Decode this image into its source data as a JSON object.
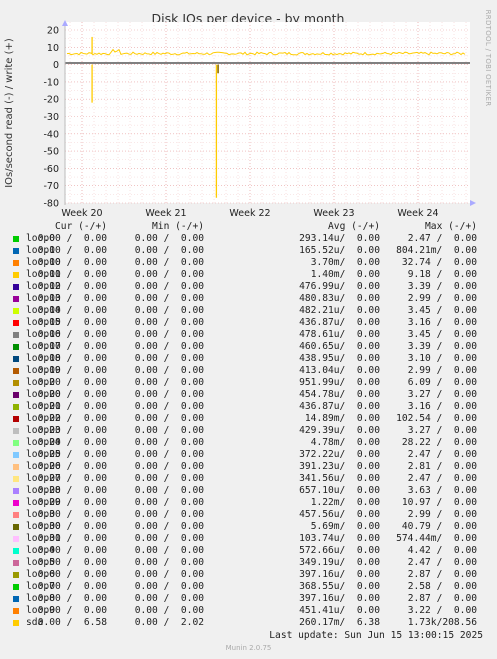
{
  "chart_data": {
    "type": "line",
    "title": "Disk IOs per device - by month",
    "ylabel": "IOs/second read (-) / write (+)",
    "ylim": [
      -80,
      20
    ],
    "yticks": [
      20,
      10,
      0,
      -10,
      -20,
      -30,
      -40,
      -50,
      -60,
      -70,
      -80
    ],
    "xticks": [
      "Week 20",
      "Week 21",
      "Week 22",
      "Week 23",
      "Week 24"
    ],
    "grid": true,
    "side_label": "RRDTOOL / TOBI OETIKER",
    "series": [
      {
        "name": "sda",
        "color": "#ffcc00",
        "write_baseline": 6.4,
        "spikes": [
          {
            "week": 0.12,
            "value": 16,
            "dir": "write"
          },
          {
            "week": 0.12,
            "value": -22,
            "dir": "read"
          },
          {
            "week": 1.6,
            "value": -77,
            "dir": "read"
          }
        ]
      }
    ],
    "dark_read_spike": {
      "week": 1.62,
      "value": -5
    }
  },
  "legend": {
    "headers": {
      "cur": "Cur (-/+)",
      "min": "Min (-/+)",
      "avg": "Avg (-/+)",
      "max": "Max (-/+)"
    },
    "rows": [
      {
        "name": "loop0",
        "color": "#00cc00",
        "cur": "0.00 /  0.00",
        "min": "0.00 /  0.00",
        "avg": "293.14u/  0.00",
        "max": "2.47 /  0.00"
      },
      {
        "name": "loop1",
        "color": "#0066b3",
        "cur": "0.00 /  0.00",
        "min": "0.00 /  0.00",
        "avg": "165.52u/  0.00",
        "max": "804.21m/  0.00"
      },
      {
        "name": "loop10",
        "color": "#ff8000",
        "cur": "0.00 /  0.00",
        "min": "0.00 /  0.00",
        "avg": "3.70m/  0.00",
        "max": "32.74 /  0.00"
      },
      {
        "name": "loop11",
        "color": "#ffcc00",
        "cur": "0.00 /  0.00",
        "min": "0.00 /  0.00",
        "avg": "1.40m/  0.00",
        "max": "9.18 /  0.00"
      },
      {
        "name": "loop12",
        "color": "#330099",
        "cur": "0.00 /  0.00",
        "min": "0.00 /  0.00",
        "avg": "476.99u/  0.00",
        "max": "3.39 /  0.00"
      },
      {
        "name": "loop13",
        "color": "#990099",
        "cur": "0.00 /  0.00",
        "min": "0.00 /  0.00",
        "avg": "480.83u/  0.00",
        "max": "2.99 /  0.00"
      },
      {
        "name": "loop14",
        "color": "#ccff00",
        "cur": "0.00 /  0.00",
        "min": "0.00 /  0.00",
        "avg": "482.21u/  0.00",
        "max": "3.45 /  0.00"
      },
      {
        "name": "loop15",
        "color": "#ff0000",
        "cur": "0.00 /  0.00",
        "min": "0.00 /  0.00",
        "avg": "436.87u/  0.00",
        "max": "3.16 /  0.00"
      },
      {
        "name": "loop16",
        "color": "#808080",
        "cur": "0.00 /  0.00",
        "min": "0.00 /  0.00",
        "avg": "478.61u/  0.00",
        "max": "3.45 /  0.00"
      },
      {
        "name": "loop17",
        "color": "#008f00",
        "cur": "0.00 /  0.00",
        "min": "0.00 /  0.00",
        "avg": "460.65u/  0.00",
        "max": "3.39 /  0.00"
      },
      {
        "name": "loop18",
        "color": "#00487d",
        "cur": "0.00 /  0.00",
        "min": "0.00 /  0.00",
        "avg": "438.95u/  0.00",
        "max": "3.10 /  0.00"
      },
      {
        "name": "loop19",
        "color": "#b35a00",
        "cur": "0.00 /  0.00",
        "min": "0.00 /  0.00",
        "avg": "413.04u/  0.00",
        "max": "2.99 /  0.00"
      },
      {
        "name": "loop2",
        "color": "#b38f00",
        "cur": "0.00 /  0.00",
        "min": "0.00 /  0.00",
        "avg": "951.99u/  0.00",
        "max": "6.09 /  0.00"
      },
      {
        "name": "loop20",
        "color": "#6b006b",
        "cur": "0.00 /  0.00",
        "min": "0.00 /  0.00",
        "avg": "454.78u/  0.00",
        "max": "3.27 /  0.00"
      },
      {
        "name": "loop21",
        "color": "#8fb300",
        "cur": "0.00 /  0.00",
        "min": "0.00 /  0.00",
        "avg": "436.87u/  0.00",
        "max": "3.16 /  0.00"
      },
      {
        "name": "loop22",
        "color": "#b30000",
        "cur": "0.00 /  0.00",
        "min": "0.00 /  0.00",
        "avg": "14.89m/  0.00",
        "max": "102.54 /  0.00"
      },
      {
        "name": "loop23",
        "color": "#bebebe",
        "cur": "0.00 /  0.00",
        "min": "0.00 /  0.00",
        "avg": "429.39u/  0.00",
        "max": "3.27 /  0.00"
      },
      {
        "name": "loop24",
        "color": "#80ff80",
        "cur": "0.00 /  0.00",
        "min": "0.00 /  0.00",
        "avg": "4.78m/  0.00",
        "max": "28.22 /  0.00"
      },
      {
        "name": "loop25",
        "color": "#80c9ff",
        "cur": "0.00 /  0.00",
        "min": "0.00 /  0.00",
        "avg": "372.22u/  0.00",
        "max": "2.47 /  0.00"
      },
      {
        "name": "loop26",
        "color": "#ffc080",
        "cur": "0.00 /  0.00",
        "min": "0.00 /  0.00",
        "avg": "391.23u/  0.00",
        "max": "2.81 /  0.00"
      },
      {
        "name": "loop27",
        "color": "#ffe680",
        "cur": "0.00 /  0.00",
        "min": "0.00 /  0.00",
        "avg": "341.56u/  0.00",
        "max": "2.47 /  0.00"
      },
      {
        "name": "loop28",
        "color": "#aa80ff",
        "cur": "0.00 /  0.00",
        "min": "0.00 /  0.00",
        "avg": "657.10u/  0.00",
        "max": "3.63 /  0.00"
      },
      {
        "name": "loop29",
        "color": "#ee00cc",
        "cur": "0.00 /  0.00",
        "min": "0.00 /  0.00",
        "avg": "1.22m/  0.00",
        "max": "10.97 /  0.00"
      },
      {
        "name": "loop3",
        "color": "#ff8080",
        "cur": "0.00 /  0.00",
        "min": "0.00 /  0.00",
        "avg": "457.56u/  0.00",
        "max": "2.99 /  0.00"
      },
      {
        "name": "loop30",
        "color": "#666600",
        "cur": "0.00 /  0.00",
        "min": "0.00 /  0.00",
        "avg": "5.69m/  0.00",
        "max": "40.79 /  0.00"
      },
      {
        "name": "loop31",
        "color": "#ffbfff",
        "cur": "0.00 /  0.00",
        "min": "0.00 /  0.00",
        "avg": "103.74u/  0.00",
        "max": "574.44m/  0.00"
      },
      {
        "name": "loop4",
        "color": "#00ffcc",
        "cur": "0.00 /  0.00",
        "min": "0.00 /  0.00",
        "avg": "572.66u/  0.00",
        "max": "4.42 /  0.00"
      },
      {
        "name": "loop5",
        "color": "#cc6699",
        "cur": "0.00 /  0.00",
        "min": "0.00 /  0.00",
        "avg": "349.19u/  0.00",
        "max": "2.47 /  0.00"
      },
      {
        "name": "loop6",
        "color": "#999900",
        "cur": "0.00 /  0.00",
        "min": "0.00 /  0.00",
        "avg": "397.16u/  0.00",
        "max": "2.87 /  0.00"
      },
      {
        "name": "loop7",
        "color": "#00cc00",
        "cur": "0.00 /  0.00",
        "min": "0.00 /  0.00",
        "avg": "368.55u/  0.00",
        "max": "2.58 /  0.00"
      },
      {
        "name": "loop8",
        "color": "#0066b3",
        "cur": "0.00 /  0.00",
        "min": "0.00 /  0.00",
        "avg": "397.16u/  0.00",
        "max": "2.87 /  0.00"
      },
      {
        "name": "loop9",
        "color": "#ff8000",
        "cur": "0.00 /  0.00",
        "min": "0.00 /  0.00",
        "avg": "451.41u/  0.00",
        "max": "3.22 /  0.00"
      },
      {
        "name": "sda",
        "color": "#ffcc00",
        "cur": "0.00 /  6.58",
        "min": "0.00 /  2.02",
        "avg": "260.17m/  6.38",
        "max": "1.73k/208.56"
      }
    ]
  },
  "footer": {
    "last_update": "Last update: Sun Jun 15 13:00:15 2025",
    "munin": "Munin 2.0.75"
  }
}
